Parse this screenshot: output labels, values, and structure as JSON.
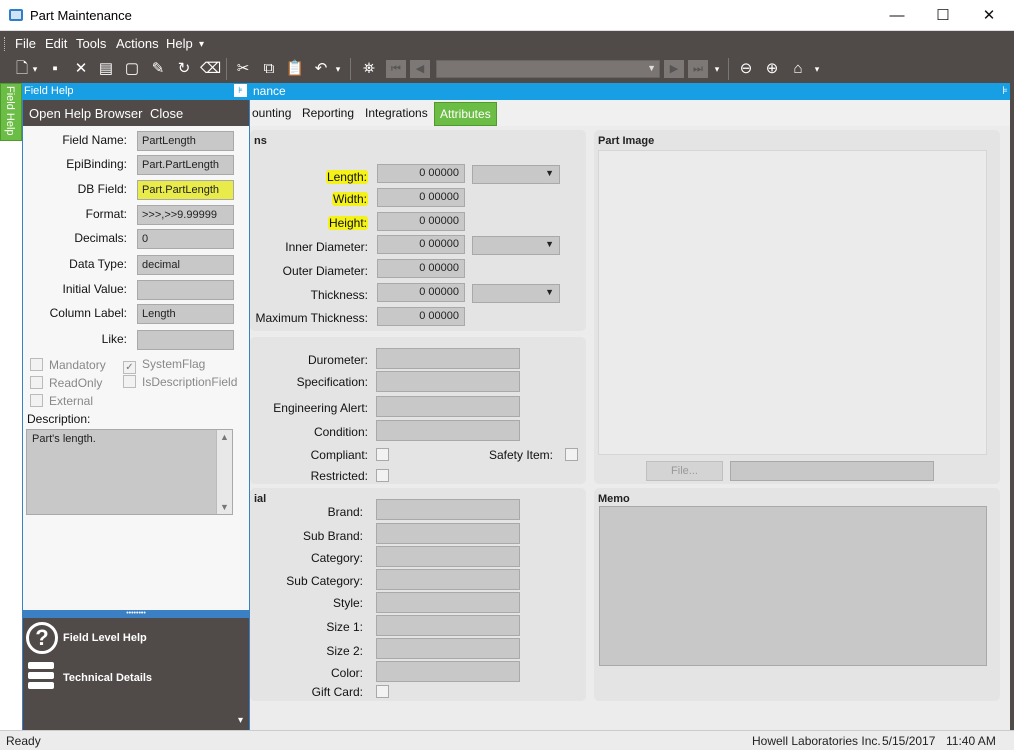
{
  "window": {
    "title": "Part Maintenance",
    "minimize": "—",
    "maximize": "☐",
    "close": "✕"
  },
  "menu": [
    "File",
    "Edit",
    "Tools",
    "Actions",
    "Help"
  ],
  "toolbar_icons": [
    "new-icon",
    "save-icon",
    "delete-icon",
    "book-icon",
    "blank-icon",
    "attach-icon",
    "refresh-icon",
    "clear-icon",
    "cut-icon",
    "copy-icon",
    "paste-icon",
    "undo-icon",
    "binoculars-icon",
    "first-icon",
    "prev-icon",
    "next-icon",
    "last-icon",
    "back-icon",
    "forward-icon",
    "home-icon"
  ],
  "form_header": "nance",
  "tabs": [
    "ounting",
    "Reporting",
    "Integrations",
    "Attributes"
  ],
  "active_tab": "Attributes",
  "dimensions": {
    "section_title": "ns",
    "length_label": "Length:",
    "length_value": "0 00000",
    "width_label": "Width:",
    "width_value": "0 00000",
    "height_label": "Height:",
    "height_value": "0 00000",
    "inner_diameter_label": "Inner Diameter:",
    "inner_diameter_value": "0 00000",
    "outer_diameter_label": "Outer Diameter:",
    "outer_diameter_value": "0 00000",
    "thickness_label": "Thickness:",
    "thickness_value": "0 00000",
    "max_thickness_label": "Maximum Thickness:",
    "max_thickness_value": "0 00000"
  },
  "specs": {
    "durometer": "Durometer:",
    "specification": "Specification:",
    "engineering_alert": "Engineering Alert:",
    "condition": "Condition:",
    "compliant": "Compliant:",
    "safety_item": "Safety Item:",
    "restricted": "Restricted:"
  },
  "material": {
    "section_title": "ial",
    "brand": "Brand:",
    "sub_brand": "Sub Brand:",
    "category": "Category:",
    "sub_category": "Sub Category:",
    "style": "Style:",
    "size1": "Size 1:",
    "size2": "Size 2:",
    "color": "Color:",
    "gift_card": "Gift Card:"
  },
  "part_image": {
    "title": "Part Image",
    "file_button": "File..."
  },
  "memo": {
    "title": "Memo"
  },
  "field_help": {
    "tab_label": "Field Help",
    "header": "Field Help",
    "open_help_browser": "Open Help Browser",
    "close": "Close",
    "field_name_label": "Field Name:",
    "field_name": "PartLength",
    "epibinding_label": "EpiBinding:",
    "epibinding": "Part.PartLength",
    "db_field_label": "DB Field:",
    "db_field": "Part.PartLength",
    "format_label": "Format:",
    "format": ">>>,>>9.99999",
    "decimals_label": "Decimals:",
    "decimals": "0",
    "data_type_label": "Data Type:",
    "data_type": "decimal",
    "initial_value_label": "Initial Value:",
    "initial_value": "",
    "column_label_label": "Column Label:",
    "column_label": "Length",
    "like_label": "Like:",
    "like": "",
    "mandatory": "Mandatory",
    "system_flag": "SystemFlag",
    "read_only": "ReadOnly",
    "is_description_field": "IsDescriptionField",
    "external": "External",
    "description_label": "Description:",
    "description": "Part's length.",
    "field_level_help": "Field Level Help",
    "technical_details": "Technical Details"
  },
  "status": {
    "left": "Ready",
    "company": "Howell Laboratories Inc.",
    "date": "5/15/2017",
    "time": "11:40 AM"
  }
}
